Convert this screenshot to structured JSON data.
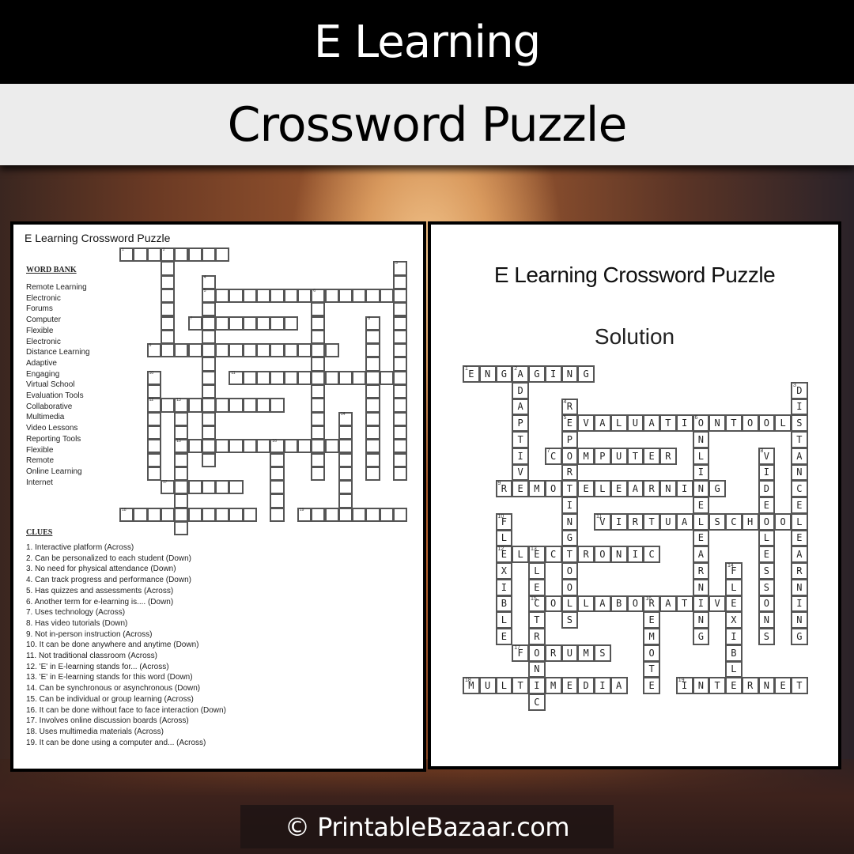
{
  "header": {
    "title": "E Learning",
    "subtitle": "Crossword Puzzle"
  },
  "puzzle_page": {
    "title": "E Learning Crossword Puzzle",
    "word_bank_heading": "WORD BANK",
    "word_bank": [
      "Remote Learning",
      "Electronic",
      "Forums",
      "Computer",
      "Flexible",
      "Electronic",
      "Distance Learning",
      "Adaptive",
      "Engaging",
      "Virtual School",
      "Evaluation Tools",
      "Collaborative",
      "Multimedia",
      "Video Lessons",
      "Reporting Tools",
      "Flexible",
      "Remote",
      "Online Learning",
      "Internet"
    ],
    "clues_heading": "CLUES",
    "clues": [
      "1. Interactive platform (Across)",
      "2. Can be personalized to each student (Down)",
      "3. No need for physical attendance (Down)",
      "4. Can track progress and performance  (Down)",
      "5. Has quizzes and assessments (Across)",
      "6. Another term for e-learning is....  (Down)",
      "7. Uses technology (Across)",
      "8. Has video tutorials (Down)",
      "9. Not in-person instruction (Across)",
      "10. It can be done anywhere and anytime  (Down)",
      "11. Not traditional classroom (Across)",
      "12. 'E' in E-learning stands for... (Across)",
      "13. 'E' in E-learning stands for this word (Down)",
      "14. Can be synchronous or asynchronous  (Down)",
      "15. Can be individual or group learning (Across)",
      "16. It can be done without  face to face interaction  (Down)",
      "17. Involves online discussion boards (Across)",
      "18. Uses multimedia materials (Across)",
      "19. It can be done using a computer  and... (Across)"
    ]
  },
  "solution_page": {
    "title": "E Learning Crossword Puzzle",
    "subtitle": "Solution"
  },
  "crossword": {
    "rows": 21,
    "cols": 21,
    "entries": [
      {
        "num": 1,
        "dir": "across",
        "row": 0,
        "col": 0,
        "answer": "ENGAGING"
      },
      {
        "num": 2,
        "dir": "down",
        "row": 0,
        "col": 3,
        "answer": "ADAPTIVE"
      },
      {
        "num": 3,
        "dir": "down",
        "row": 1,
        "col": 20,
        "answer": "DISTANCELEARNING"
      },
      {
        "num": 4,
        "dir": "down",
        "row": 2,
        "col": 6,
        "answer": "REPORTINGTOOLS"
      },
      {
        "num": 5,
        "dir": "across",
        "row": 3,
        "col": 6,
        "answer": "EVALUATIONTOOLS"
      },
      {
        "num": 6,
        "dir": "down",
        "row": 3,
        "col": 14,
        "answer": "ONLINELEARNING"
      },
      {
        "num": 7,
        "dir": "across",
        "row": 5,
        "col": 5,
        "answer": "COMPUTER"
      },
      {
        "num": 8,
        "dir": "down",
        "row": 5,
        "col": 18,
        "answer": "VIDEOLESSONS"
      },
      {
        "num": 9,
        "dir": "across",
        "row": 7,
        "col": 2,
        "answer": "REMOTELEARNING"
      },
      {
        "num": 10,
        "dir": "down",
        "row": 9,
        "col": 2,
        "answer": "FLEXIBLE"
      },
      {
        "num": 11,
        "dir": "across",
        "row": 9,
        "col": 8,
        "answer": "VIRTUALSCHOOL"
      },
      {
        "num": 12,
        "dir": "across",
        "row": 11,
        "col": 2,
        "answer": "ELECTRONIC"
      },
      {
        "num": 13,
        "dir": "down",
        "row": 11,
        "col": 4,
        "answer": "ELECTRONIC"
      },
      {
        "num": 14,
        "dir": "down",
        "row": 12,
        "col": 16,
        "answer": "FLEXIBLE"
      },
      {
        "num": 15,
        "dir": "across",
        "row": 14,
        "col": 4,
        "answer": "COLLABORATIVE"
      },
      {
        "num": 16,
        "dir": "down",
        "row": 14,
        "col": 11,
        "answer": "REMOTE"
      },
      {
        "num": 17,
        "dir": "across",
        "row": 17,
        "col": 3,
        "answer": "FORUMS"
      },
      {
        "num": 18,
        "dir": "across",
        "row": 19,
        "col": 0,
        "answer": "MULTIMEDIA"
      },
      {
        "num": 19,
        "dir": "across",
        "row": 19,
        "col": 13,
        "answer": "INTERNET"
      }
    ]
  },
  "footer": {
    "copyright": "© PrintableBazaar.com"
  }
}
